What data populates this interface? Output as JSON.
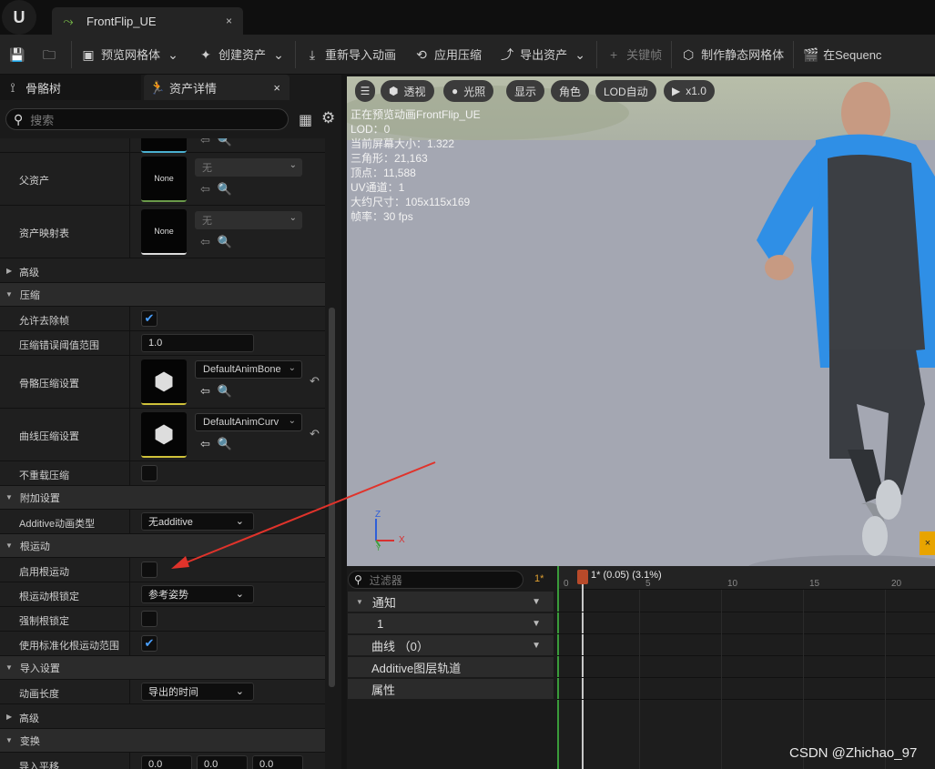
{
  "tab": {
    "title": "FrontFlip_UE",
    "close": "×"
  },
  "toolbar": {
    "preview_mesh": "预览网格体",
    "create_asset": "创建资产",
    "reimport": "重新导入动画",
    "apply_compression": "应用压缩",
    "export_asset": "导出资产",
    "keyframe": "关键帧",
    "make_static": "制作静态网格体",
    "in_sequencer": "在Sequenc"
  },
  "left": {
    "tab_skeleton": "骨骼树",
    "tab_details": "资产详情",
    "close": "×",
    "search_placeholder": "搜索",
    "parent_asset": {
      "label": "父资产",
      "thumb": "None",
      "combo": "无"
    },
    "asset_map": {
      "label": "资产映射表",
      "thumb": "None",
      "combo": "无"
    },
    "advanced1": "高级",
    "compression": "压缩",
    "allow_remove": {
      "label": "允许去除帧"
    },
    "error_threshold": {
      "label": "压缩错误阈值范围",
      "value": "1.0"
    },
    "bone_comp": {
      "label": "骨骼压缩设置",
      "combo": "DefaultAnimBone"
    },
    "curve_comp": {
      "label": "曲线压缩设置",
      "combo": "DefaultAnimCurv"
    },
    "no_recompress": {
      "label": "不重载压缩"
    },
    "additive_settings": "附加设置",
    "additive_type": {
      "label": "Additive动画类型",
      "value": "无additive"
    },
    "root_motion": "根运动",
    "enable_root": {
      "label": "启用根运动"
    },
    "root_lock": {
      "label": "根运动根锁定",
      "value": "参考姿势"
    },
    "force_root_lock": {
      "label": "强制根锁定"
    },
    "normalized_root": {
      "label": "使用标准化根运动范围"
    },
    "import_settings": "导入设置",
    "anim_length": {
      "label": "动画长度",
      "value": "导出的时间"
    },
    "advanced2": "高级",
    "transform": "变换",
    "import_translation": {
      "label": "导入平移",
      "v1": "0.0",
      "v2": "0.0",
      "v3": "0.0"
    }
  },
  "viewport": {
    "menu": "☰",
    "perspective": "透视",
    "lighting": "光照",
    "show": "显示",
    "character": "角色",
    "lod_auto": "LOD自动",
    "speed": "x1.0",
    "stats": [
      "正在预览动画FrontFlip_UE",
      "LOD：0",
      "当前屏幕大小：1.322",
      "三角形：21,163",
      "顶点：11,588",
      "UV通道：1",
      "大约尺寸：105x115x169",
      "帧率：30 fps"
    ],
    "axis_z": "Z",
    "axis_x": "X",
    "axis_y": "Y"
  },
  "timeline": {
    "filter_placeholder": "过滤器",
    "frame_badge": "1*",
    "notify": "通知",
    "notify_track": "1",
    "curves": "曲线 （0）",
    "additive_layer": "Additive图层轨道",
    "attributes": "属性",
    "playhead_label": "1* (0.05) (3.1%)",
    "ticks": [
      "0",
      "5",
      "10",
      "15",
      "20"
    ]
  },
  "watermark": "CSDN @Zhichao_97",
  "colors": {
    "accent_blue": "#4aa0ff",
    "arrow_red": "#e0332b",
    "hoodie_blue": "#2f8fe6"
  }
}
